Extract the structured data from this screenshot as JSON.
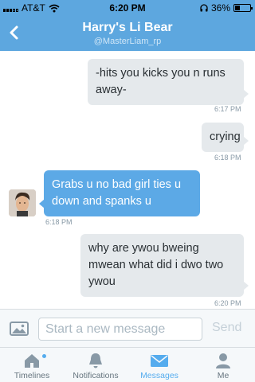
{
  "status": {
    "carrier": "AT&T",
    "time": "6:20 PM",
    "battery": "36%",
    "battery_level": 0.36
  },
  "header": {
    "title": "Harry's Li Bear",
    "username": "@MasterLiam_rp"
  },
  "messages": [
    {
      "direction": "outgoing",
      "text": "-hits you kicks you n runs away-",
      "time": "6:17 PM"
    },
    {
      "direction": "outgoing",
      "text": "crying",
      "time": "6:18 PM"
    },
    {
      "direction": "incoming",
      "text": "Grabs u no bad girl ties u down and spanks u",
      "time": "6:18 PM"
    },
    {
      "direction": "outgoing",
      "text": "why are ywou bweing mwean what did i dwo two ywou",
      "time": "6:20 PM"
    }
  ],
  "composer": {
    "placeholder": "Start a new message",
    "send_label": "Send"
  },
  "tabs": [
    {
      "label": "Timelines",
      "icon": "home-icon",
      "active": false,
      "notification": true
    },
    {
      "label": "Notifications",
      "icon": "bell-icon",
      "active": false,
      "notification": false
    },
    {
      "label": "Messages",
      "icon": "envelope-icon",
      "active": true,
      "notification": false
    },
    {
      "label": "Me",
      "icon": "person-icon",
      "active": false,
      "notification": false
    }
  ],
  "colors": {
    "brand": "#5da7df",
    "incoming_bubble": "#5ca9e6",
    "outgoing_bubble": "#e5e9ec",
    "active_tab": "#55acee"
  }
}
